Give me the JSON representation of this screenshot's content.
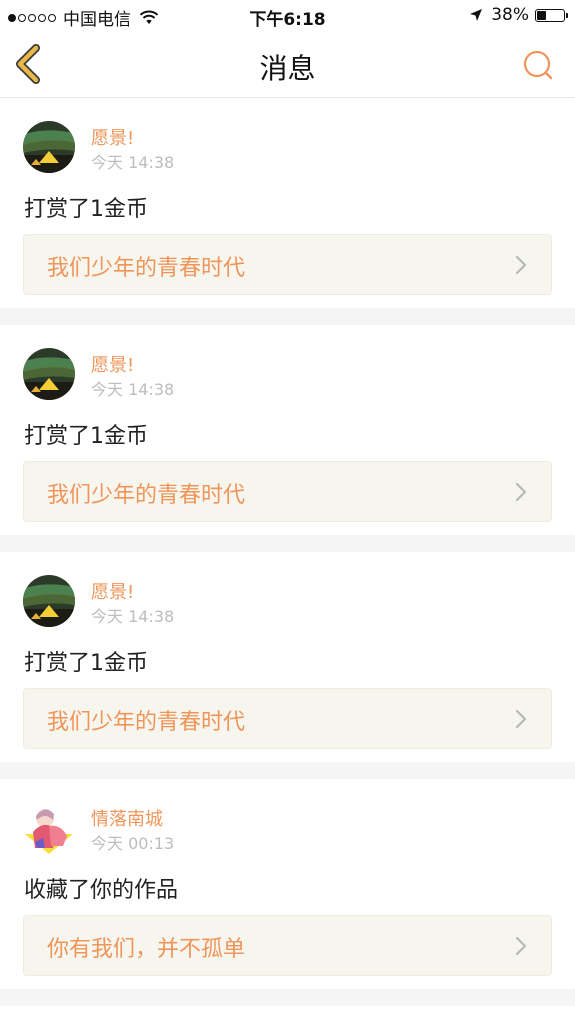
{
  "status_bar": {
    "carrier": "中国电信",
    "time": "下午6:18",
    "battery_percent": "38%",
    "battery_level": 0.38,
    "signal_bars_filled": 1,
    "signal_bars_total": 5
  },
  "header": {
    "title": "消息",
    "back_icon": "chevron-left-icon",
    "search_icon": "search-icon"
  },
  "colors": {
    "accent": "#f0955a",
    "back_arrow": "#e8b84a",
    "timestamp": "#bdbdbd",
    "link_bg": "#f6f6ef"
  },
  "messages": [
    {
      "username": "愿景!",
      "time": "今天 14:38",
      "action": "打赏了1金币",
      "work_title": "我们少年的青春时代",
      "avatar": "aurora-tent-avatar"
    },
    {
      "username": "愿景!",
      "time": "今天 14:38",
      "action": "打赏了1金币",
      "work_title": "我们少年的青春时代",
      "avatar": "aurora-tent-avatar"
    },
    {
      "username": "愿景!",
      "time": "今天 14:38",
      "action": "打赏了1金币",
      "work_title": "我们少年的青春时代",
      "avatar": "aurora-tent-avatar"
    },
    {
      "username": "情落南城",
      "time": "今天 00:13",
      "action": "收藏了你的作品",
      "work_title": "你有我们，并不孤单",
      "avatar": "illustrated-girl-avatar"
    }
  ]
}
